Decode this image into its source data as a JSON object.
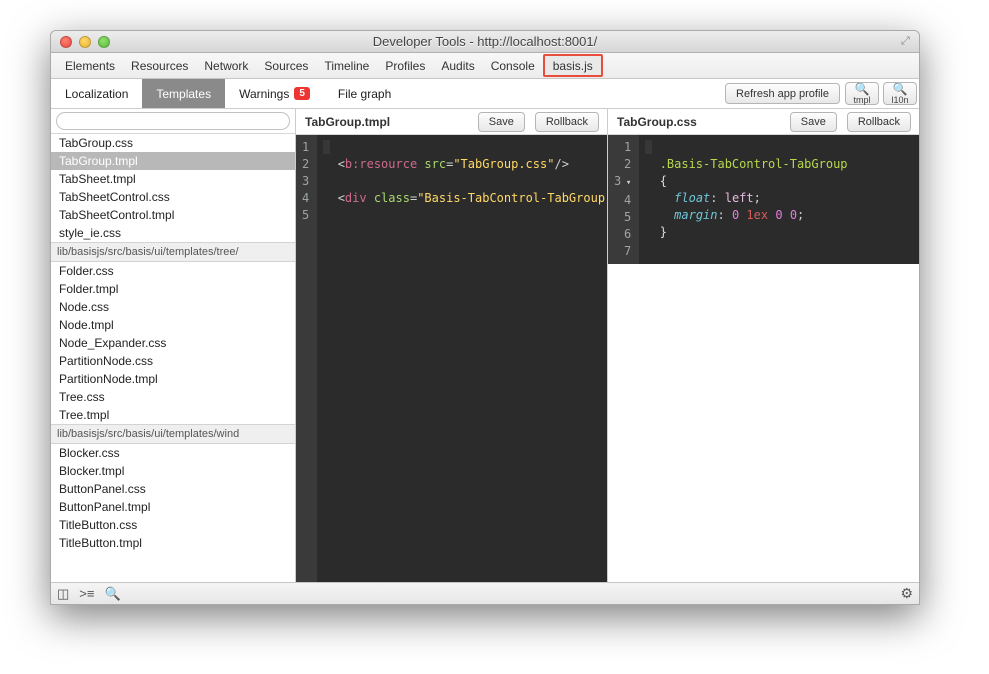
{
  "window": {
    "title": "Developer Tools - http://localhost:8001/"
  },
  "devtabs": [
    "Elements",
    "Resources",
    "Network",
    "Sources",
    "Timeline",
    "Profiles",
    "Audits",
    "Console",
    "basis.js"
  ],
  "subtabs": {
    "localization": "Localization",
    "templates": "Templates",
    "warnings": "Warnings",
    "warnings_badge": "5",
    "filegraph": "File graph"
  },
  "toolbar": {
    "refresh": "Refresh app profile",
    "tmpl": "tmpl",
    "l10n": "l10n"
  },
  "search": {
    "placeholder": ""
  },
  "files_group1": [
    "TabGroup.css",
    "TabGroup.tmpl",
    "TabSheet.tmpl",
    "TabSheetControl.css",
    "TabSheetControl.tmpl",
    "style_ie.css"
  ],
  "group2_label": "lib/basisjs/src/basis/ui/templates/tree/",
  "files_group2": [
    "Folder.css",
    "Folder.tmpl",
    "Node.css",
    "Node.tmpl",
    "Node_Expander.css",
    "PartitionNode.css",
    "PartitionNode.tmpl",
    "Tree.css",
    "Tree.tmpl"
  ],
  "group3_label": "lib/basisjs/src/basis/ui/templates/wind",
  "files_group3": [
    "Blocker.css",
    "Blocker.tmpl",
    "ButtonPanel.css",
    "ButtonPanel.tmpl",
    "TitleButton.css",
    "TitleButton.tmpl"
  ],
  "left_editor": {
    "name": "TabGroup.tmpl",
    "save": "Save",
    "rollback": "Rollback",
    "code": {
      "l2a": "<",
      "l2b": "b:resource",
      "l2c": " src",
      "l2d": "=",
      "l2e": "\"TabGroup.css\"",
      "l2f": "/>",
      "l4a": "<",
      "l4b": "div",
      "l4c": " class",
      "l4d": "=",
      "l4e": "\"Basis-TabControl-TabGroup\""
    }
  },
  "right_editor": {
    "name": "TabGroup.css",
    "save": "Save",
    "rollback": "Rollback",
    "code": {
      "sel": ".Basis-TabControl-TabGroup",
      "ob": "{",
      "p1": "float",
      "v1": "left",
      "sc": ";",
      "p2": "margin",
      "n0": "0",
      "u1": "1ex",
      "n2": "0",
      "n3": "0",
      "cb": "}"
    }
  }
}
